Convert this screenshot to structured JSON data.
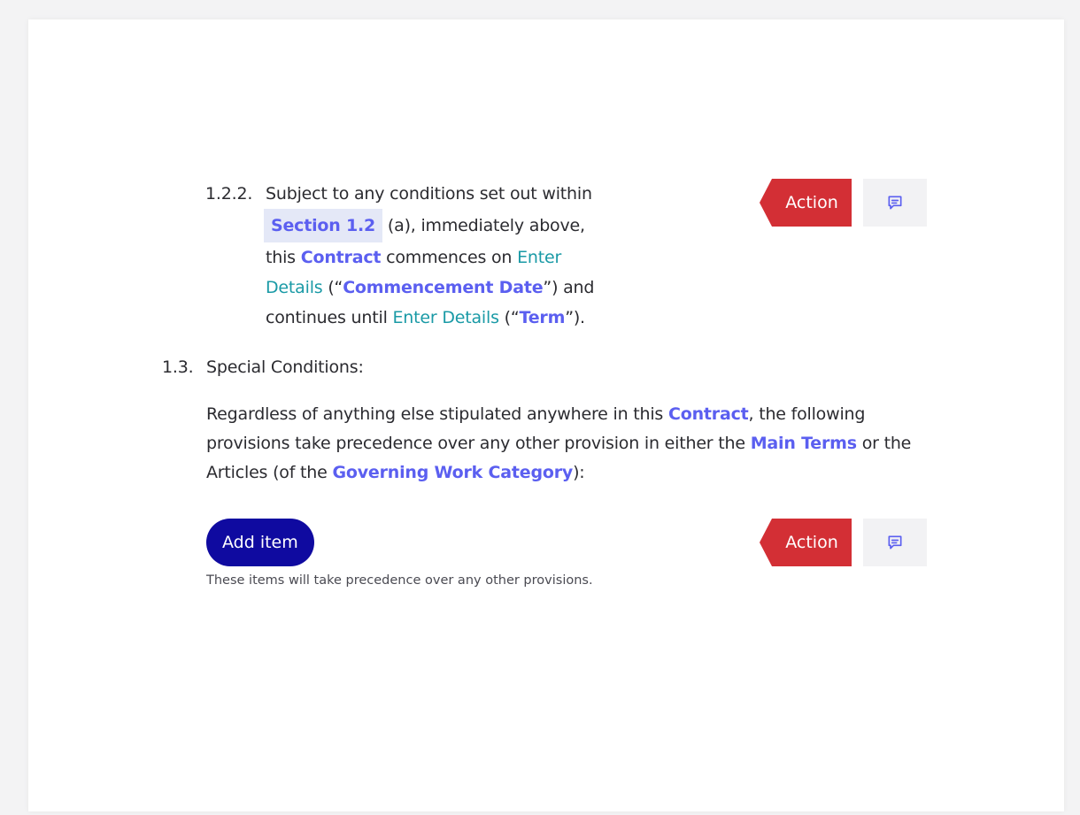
{
  "clause_1_2_2": {
    "number": "1.2.2.",
    "line1": "Subject to any conditions set out within",
    "ref_chip": "Section 1.2",
    "after_chip": " (a), immediately above,",
    "this": "this ",
    "contract": "Contract",
    "commences_on": " commences on ",
    "enter_details_1": "Enter Details",
    "open_quote_1": " (“",
    "commencement_date": "Commencement Date",
    "close_and": "”) and",
    "continues_until": "continues until ",
    "enter_details_2": "Enter Details",
    "open_quote_2": " (“",
    "term": "Term",
    "close_end": "”)."
  },
  "clause_1_3": {
    "number": "1.3.",
    "title": "Special Conditions:",
    "p1": "Regardless of anything else stipulated anywhere in this ",
    "contract": "Contract",
    "p2": ", the following provisions take precedence over any other provision in either the ",
    "main_terms": "Main Terms",
    "p3": " or the Articles (of the ",
    "governing_work_category": "Governing Work Category",
    "p4": "):"
  },
  "add_item": {
    "label": "Add item",
    "helper": "These items will take precedence over any other provisions."
  },
  "actions": {
    "action_label": "Action"
  },
  "colors": {
    "keyword": "#5b5ff0",
    "placeholder": "#1a9aa6",
    "action_red": "#d32f35",
    "add_item_navy": "#0f0aa0"
  },
  "icons": {
    "comment": "message-square-icon"
  }
}
